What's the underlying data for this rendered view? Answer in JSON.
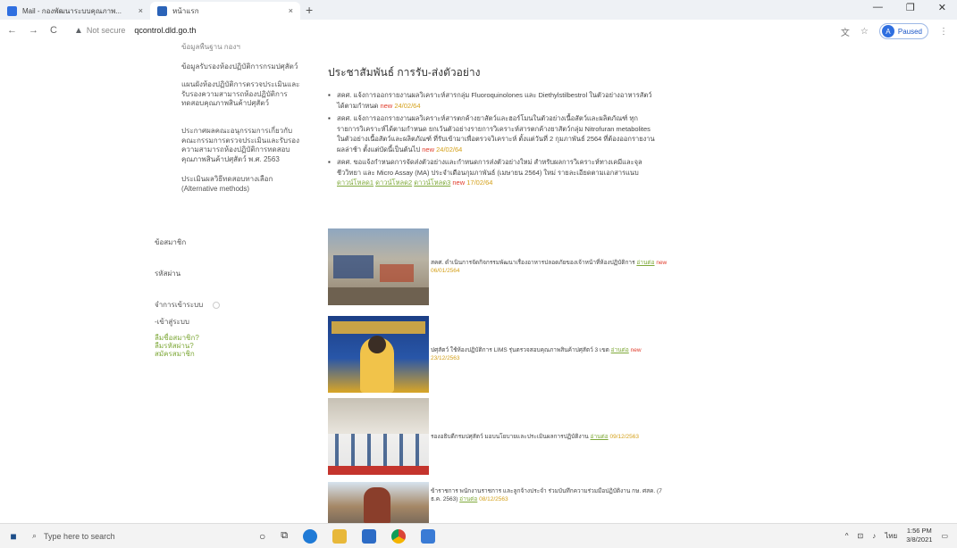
{
  "browser": {
    "tabs": [
      {
        "title": "Mail - กองพัฒนาระบบคุณภาพ...",
        "close": "×"
      },
      {
        "title": "หน้าแรก",
        "close": "×"
      }
    ],
    "new_tab": "+",
    "window_controls": [
      "—",
      "❐",
      "✕"
    ],
    "back": "←",
    "forward": "→",
    "reload": "C",
    "not_secure": "Not secure",
    "url": "qcontrol.dld.go.th",
    "profile_initial": "A",
    "profile_status": "Paused"
  },
  "sidebar": {
    "items": [
      {
        "label": "ข้อมูลพื้นฐาน กองฯ"
      },
      {
        "label": "ข้อมูลรับรองห้องปฏิบัติการกรมปศุสัตว์"
      },
      {
        "label": "แผนผังห้องปฏิบัติการตรวจประเมินและรับรองความสามารถห้องปฏิบัติการทดสอบคุณภาพสินค้าปศุสัตว์"
      },
      {
        "label": "ประกาศผลคณะอนุกรรมการเกี่ยวกับคณะกรรมการตรวจประเมินและรับรองความสามารถห้องปฏิบัติการทดสอบคุณภาพสินค้าปศุสัตว์ พ.ศ. 2563"
      },
      {
        "label": "ประเมินผลวิธีทดสอบทางเลือก (Alternative methods)"
      }
    ],
    "member_title": "ข้อสมาชิก",
    "password_title": "รหัสผ่าน",
    "remember": "จำการเข้าระบบ",
    "login": "-เข้าสู่ระบบ",
    "links": [
      "ลืมชื่อสมาชิก?",
      "ลืมรหัสผ่าน?",
      "สมัครสมาชิก"
    ]
  },
  "main": {
    "heading": "ประชาสัมพันธ์ การรับ-ส่งตัวอย่าง",
    "bullets": [
      {
        "text": "สคศ. แจ้งการออกรายงานผลวิเคราะห์สารกลุ่ม Fluoroquinolones และ Diethylstilbestrol ในตัวอย่างอาหารสัตว์ได้ตามกำหนด",
        "new": "new",
        "date": "24/02/64"
      },
      {
        "text": "สคศ. แจ้งการออกรายงานผลวิเคราะห์สารตกค้างยาสัตว์และฮอร์โมนในตัวอย่างเนื้อสัตว์และผลิตภัณฑ์ ทุกรายการวิเคราะห์ได้ตามกำหนด ยกเว้นตัวอย่างรายการวิเคราะห์สารตกค้างยาสัตว์กลุ่ม Nitrofuran metabolites ในตัวอย่างเนื้อสัตว์และผลิตภัณฑ์ ที่รับเข้ามาเพื่อตรวจวิเคราะห์ ตั้งแต่วันที่ 2 กุมภาพันธ์ 2564 ที่ต้องออกรายงานผลล่าช้า ตั้งแต่บัดนี้เป็นต้นไป",
        "new": "new",
        "date": "24/02/64"
      },
      {
        "text": "สคศ. ขอแจ้งกำหนดการจัดส่งตัวอย่างและกำหนดการส่งตัวอย่างใหม่ สำหรับผลการวิเคราะห์ทางเคมีและจุลชีววิทยา และ Micro Assay (MA) ประจำเดือนกุมภาพันธ์ (เมษายน 2564) ใหม่ รายละเอียดตามเอกสารแนบ",
        "links": [
          "ดาวน์โหลด1",
          "ดาวน์โหลด2",
          "ดาวน์โหลด3"
        ],
        "new": "new",
        "date": "17/02/64"
      }
    ]
  },
  "news": [
    {
      "caption": "สคศ. ดำเนินการจัดกิจกรรมพัฒนาเรื่องอาหารปลอดภัยของเจ้าหน้าที่ห้องปฏิบัติการ",
      "more": "อ่านต่อ",
      "new": "new",
      "date": "06/01/2564"
    },
    {
      "caption": "ปศุสัตว์ ใช้ห้องปฏิบัติการ LIMS รุ่นตรวจสอบคุณภาพสินค้าปศุสัตว์ 3 เขต",
      "more": "อ่านต่อ",
      "new": "new",
      "date": "23/12/2563"
    },
    {
      "caption": "รองอธิบดีกรมปศุสัตว์ มอบนโยบายและประเมินผลการปฏิบัติงาน",
      "more": "อ่านต่อ",
      "date": "09/12/2563"
    },
    {
      "caption": "ข้าราชการ พนักงานราชการ และลูกจ้างประจำ ร่วมบันทึกความร่วมมือปฏิบัติงาน กษ. ศสค. (7 ธ.ค. 2563)",
      "more": "อ่านต่อ",
      "date": "08/12/2563"
    }
  ],
  "taskbar": {
    "search_placeholder": "Type here to search",
    "lang": "ไทย",
    "time": "1:56 PM",
    "date": "3/8/2021"
  }
}
